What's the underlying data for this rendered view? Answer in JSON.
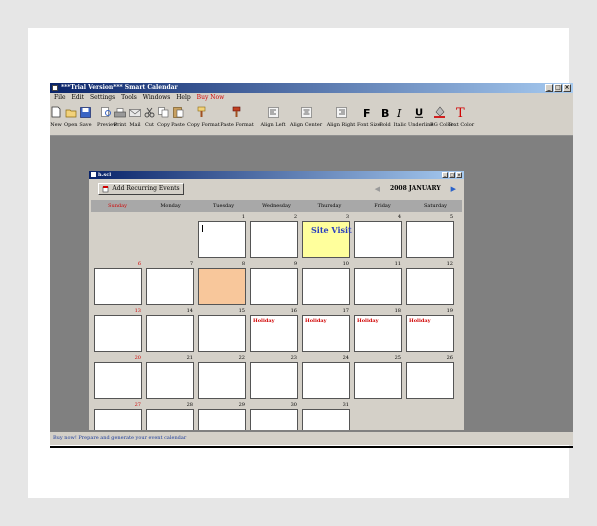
{
  "window": {
    "title": "***Trial Version*** Smart Calendar",
    "buttons": [
      "_",
      "□",
      "×"
    ]
  },
  "menu": {
    "items": [
      "File",
      "Edit",
      "Settings",
      "Tools",
      "Windows",
      "Help",
      "Buy Now"
    ]
  },
  "toolbar": {
    "items": [
      {
        "label": "New",
        "icon": "new-file-icon"
      },
      {
        "label": "Open",
        "icon": "open-folder-icon"
      },
      {
        "label": "Save",
        "icon": "save-disk-icon"
      },
      {
        "label": "Preview",
        "icon": "preview-magnifier-icon"
      },
      {
        "label": "Print",
        "icon": "printer-icon"
      },
      {
        "label": "Mail",
        "icon": "mail-icon"
      },
      {
        "label": "Cut",
        "icon": "scissors-icon"
      },
      {
        "label": "Copy",
        "icon": "copy-icon"
      },
      {
        "label": "Paste",
        "icon": "paste-icon"
      },
      {
        "label": "Copy Format",
        "icon": "copy-format-icon"
      },
      {
        "label": "Paste Format",
        "icon": "paste-format-icon"
      },
      {
        "label": "Align Left",
        "icon": "align-left-icon"
      },
      {
        "label": "Align Center",
        "icon": "align-center-icon"
      },
      {
        "label": "Align Right",
        "icon": "align-right-icon"
      },
      {
        "label": "Font Size",
        "icon": "font-size-icon"
      },
      {
        "label": "Bold",
        "icon": "bold-icon"
      },
      {
        "label": "Italic",
        "icon": "italic-icon"
      },
      {
        "label": "Underline",
        "icon": "underline-icon"
      },
      {
        "label": "BG Color",
        "icon": "bg-color-icon"
      },
      {
        "label": "Text Color",
        "icon": "text-color-icon"
      }
    ]
  },
  "calendar_window": {
    "title": "h.scl",
    "add_button": "Add Recurring Events",
    "month_label": "2008 JANUARY",
    "prev_icon": "prev-arrow-icon",
    "next_icon": "next-arrow-icon",
    "days": [
      "Sunday",
      "Monday",
      "Tuesday",
      "Wednesday",
      "Thursday",
      "Friday",
      "Saturday"
    ],
    "weeks": [
      [
        {
          "d": ""
        },
        {
          "d": ""
        },
        {
          "d": "1",
          "cursor": true
        },
        {
          "d": "2"
        },
        {
          "d": "3",
          "event": "Site Visit",
          "hl": "yellow"
        },
        {
          "d": "4"
        },
        {
          "d": "5"
        }
      ],
      [
        {
          "d": "6",
          "red": true
        },
        {
          "d": "7"
        },
        {
          "d": "8",
          "hl": "peach"
        },
        {
          "d": "9"
        },
        {
          "d": "10"
        },
        {
          "d": "11"
        },
        {
          "d": "12"
        }
      ],
      [
        {
          "d": "13",
          "red": true
        },
        {
          "d": "14"
        },
        {
          "d": "15"
        },
        {
          "d": "16",
          "event": "Holiday"
        },
        {
          "d": "17",
          "event": "Holiday"
        },
        {
          "d": "18",
          "event": "Holiday"
        },
        {
          "d": "19",
          "event": "Holiday"
        }
      ],
      [
        {
          "d": "20",
          "red": true
        },
        {
          "d": "21"
        },
        {
          "d": "22"
        },
        {
          "d": "23"
        },
        {
          "d": "24"
        },
        {
          "d": "25"
        },
        {
          "d": "26"
        }
      ],
      [
        {
          "d": "27",
          "red": true
        },
        {
          "d": "28"
        },
        {
          "d": "29"
        },
        {
          "d": "30"
        },
        {
          "d": "31"
        },
        {
          "d": ""
        },
        {
          "d": ""
        }
      ]
    ]
  },
  "status": {
    "text": "Buy now! Prepare and generate your event calendar"
  },
  "colors": {
    "title_gradient_start": "#0a246a",
    "sunday_red": "#d00000",
    "holiday_red": "#d00000",
    "site_visit_blue": "#2a3fbf",
    "highlight_yellow": "#ffff9c",
    "highlight_peach": "#f8c79b"
  }
}
